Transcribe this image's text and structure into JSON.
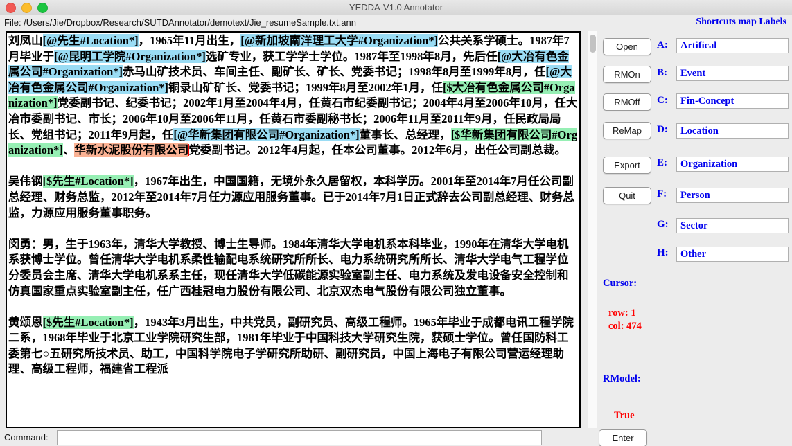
{
  "window": {
    "title": "YEDDA-V1.0 Annotator",
    "traffic_lights": [
      "close-red",
      "minimize-yellow",
      "maximize-green"
    ]
  },
  "header": {
    "file_label": "File: /Users/Jie/Dropbox/Research/SUTDAnnotator/demotext/Jie_resumeSample.txt.ann",
    "shortcuts_link": "Shortcuts map Labels"
  },
  "editor": {
    "paragraphs": [
      {
        "id": "p1",
        "segments": [
          {
            "t": "刘凤山",
            "h": "none"
          },
          {
            "t": "[@先生#Location*]",
            "h": "blue"
          },
          {
            "t": "，1965年11月出生，",
            "h": "none"
          },
          {
            "t": "[@新加坡南洋理工大学#Organization*]",
            "h": "blue"
          },
          {
            "t": "公共关系学硕士。1987年7月毕业于",
            "h": "none"
          },
          {
            "t": "[@昆明工学院#Organization*]",
            "h": "blue"
          },
          {
            "t": "选矿专业，获工学学士学位。1987年至1998年8月，先后任",
            "h": "none"
          },
          {
            "t": "[@大冶有色金属公司#Organization*]",
            "h": "blue"
          },
          {
            "t": "赤马山矿技术员、车间主任、副矿长、矿长、党委书记；1998年8月至1999年8月，任",
            "h": "none"
          },
          {
            "t": "[@大冶有色金属公司#Organization*]",
            "h": "blue"
          },
          {
            "t": "铜录山矿矿长、党委书记；1999年8月至2002年1月，任",
            "h": "none"
          },
          {
            "t": "[$大冶有色金属公司#Organization*]",
            "h": "green"
          },
          {
            "t": "党委副书记、纪委书记；2002年1月至2004年4月，任黄石市纪委副书记；2004年4月至2006年10月，任大冶市委副书记、市长；2006年10月至2006年11月，任黄石市委副秘书长；2006年11月至2011年9月，任民政局局长、党组书记；2011年9月起，任",
            "h": "none"
          },
          {
            "t": "[@华新集团有限公司#Organization*]",
            "h": "blue"
          },
          {
            "t": "董事长、总经理，",
            "h": "none"
          },
          {
            "t": "[$华新集团有限公司#Organization*]",
            "h": "green"
          },
          {
            "t": "、",
            "h": "none"
          },
          {
            "t": "华新水泥股份有限公司",
            "h": "selection"
          },
          {
            "t": "",
            "h": "caret"
          },
          {
            "t": "党委副书记。2012年4月起，任本公司董事。2012年6月，出任公司副总裁。",
            "h": "none"
          }
        ]
      },
      {
        "id": "p2",
        "segments": [
          {
            "t": "吴伟钢",
            "h": "none"
          },
          {
            "t": "[$先生#Location*]",
            "h": "green"
          },
          {
            "t": "，1967年出生，中国国籍，无境外永久居留权，本科学历。2001年至2014年7月任公司副总经理、财务总监，2012年至2014年7月任力源应用服务董事。已于2014年7月1日正式辞去公司副总经理、财务总监，力源应用服务董事职务。",
            "h": "none"
          }
        ]
      },
      {
        "id": "p3",
        "segments": [
          {
            "t": "闵勇：男，生于1963年，清华大学教授、博士生导师。1984年清华大学电机系本科毕业，1990年在清华大学电机系获博士学位。曾任清华大学电机系柔性输配电系统研究所所长、电力系统研究所所长、清华大学电气工程学位分委员会主席、清华大学电机系系主任，现任清华大学低碳能源实验室副主任、电力系统及发电设备安全控制和仿真国家重点实验室副主任，任广西桂冠电力股份有限公司、北京双杰电气股份有限公司独立董事。",
            "h": "none"
          }
        ]
      },
      {
        "id": "p4",
        "segments": [
          {
            "t": "黄颂恩",
            "h": "none"
          },
          {
            "t": "[$先生#Location*]",
            "h": "green"
          },
          {
            "t": "，1943年3月出生，中共党员，副研究员、高级工程师。1965年毕业于成都电讯工程学院二系，1968年毕业于北京工业学院研究生部，1981年毕业于中国科技大学研究生院，获硕士学位。曾任国防科工委第七○五研究所技术员、助工，中国科学院电子学研究所助研、副研究员，中国上海电子有限公司营运经理助理、高级工程师，福建省工程派",
            "h": "none"
          }
        ]
      }
    ],
    "highlight_colors": {
      "blue": "#9adcf4",
      "green": "#96efb4",
      "selection": "#fbb294",
      "caret": "#ff0000"
    }
  },
  "scrollbar": {
    "orientation": "vertical",
    "thumb_position_pct": 1
  },
  "sidebar": {
    "buttons": [
      {
        "label": "Open"
      },
      {
        "label": "RMOn"
      },
      {
        "label": "RMOff"
      },
      {
        "label": "ReMap"
      },
      {
        "label": "Export"
      },
      {
        "label": "Quit"
      }
    ],
    "shortcuts": [
      {
        "key": "A:",
        "value": "Artifical"
      },
      {
        "key": "B:",
        "value": "Event"
      },
      {
        "key": "C:",
        "value": "Fin-Concept"
      },
      {
        "key": "D:",
        "value": "Location"
      },
      {
        "key": "E:",
        "value": "Organization"
      },
      {
        "key": "F:",
        "value": "Person"
      },
      {
        "key": "G:",
        "value": "Sector"
      },
      {
        "key": "H:",
        "value": "Other"
      }
    ],
    "cursor_heading": "Cursor:",
    "cursor_value": "row: 1\ncol: 474",
    "rmodel_heading": "RModel:",
    "rmodel_value": "True",
    "accent_blue": "#0000ee",
    "accent_red": "#ff0000"
  },
  "footer": {
    "command_label": "Command:",
    "command_value": "",
    "command_placeholder": "",
    "enter_label": "Enter"
  }
}
